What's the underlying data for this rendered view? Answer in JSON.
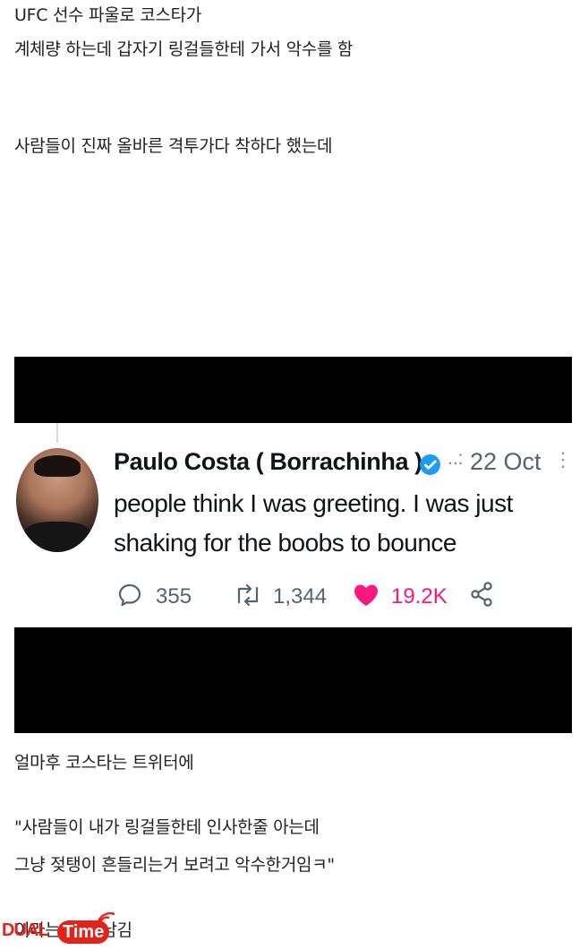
{
  "post": {
    "lines_top": [
      "UFC 선수 파울로 코스타가",
      "계체량 하는데 갑자기 링걸들한테 가서 악수를 함"
    ],
    "line_mid": "사람들이 진짜 올바른 격투가다 착하다 했는데",
    "lines_after": [
      "얼마후 코스타는 트위터에",
      "\"사람들이 내가 링걸들한테 인사한줄 아는데",
      "그냥 젖탱이 흔들리는거 보려고 악수한거임ㅋ\"",
      "이라는 트윗 남김"
    ]
  },
  "tweet": {
    "author": "Paulo Costa ( Borrachinha )",
    "separator": "..:",
    "date": "22 Oct",
    "more": "⋮",
    "text_lines": [
      "people think I was greeting.  I was just",
      "shaking for the boobs to bounce"
    ],
    "replies": "355",
    "retweets": "1,344",
    "likes": "19.2K",
    "icons": [
      "verified-badge-icon",
      "reply-icon",
      "retweet-icon",
      "like-heart-icon",
      "share-icon",
      "more-options-icon"
    ],
    "colors": {
      "verified": "#1d9bf0",
      "like": "#f91880",
      "muted": "#536471"
    }
  },
  "watermark": {
    "brand": "DUAL",
    "product": "Time",
    "color": "#e2231a"
  }
}
